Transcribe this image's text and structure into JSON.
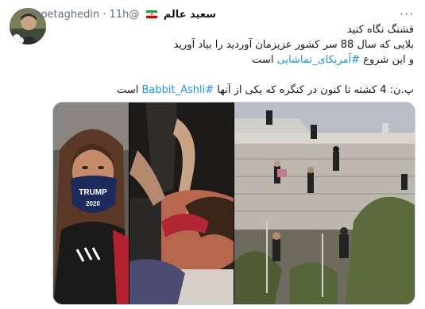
{
  "tweet": {
    "display_name": "سعید عالم",
    "handle": "@moetaghedin",
    "separator": "·",
    "time": "11h",
    "more_label": "···",
    "lines": [
      "قشنگ نگاه کنید",
      "بلایی که سال 88 سر کشور عزیزمان آوردید را بیاد آورید"
    ],
    "line3_prefix": "و این شروع ",
    "line3_hashtag": "#آمریکای_تماشایی",
    "line3_suffix": " است",
    "line4_prefix": "پ.ن: 4 کشته تا کنون در کنگره که یکی از آنها ",
    "line4_hashtag": "#Babbit_Ashli",
    "line4_suffix": " است"
  },
  "media": {
    "photos": [
      "woman-trump-mask-photo",
      "injured-woman-floor-photo",
      "capitol-wall-climbers-photo"
    ],
    "mask_text": [
      "TRUMP",
      "2020"
    ]
  },
  "colors": {
    "link": "#1b95e0",
    "text": "#14171a",
    "secondary": "#5b7083"
  }
}
